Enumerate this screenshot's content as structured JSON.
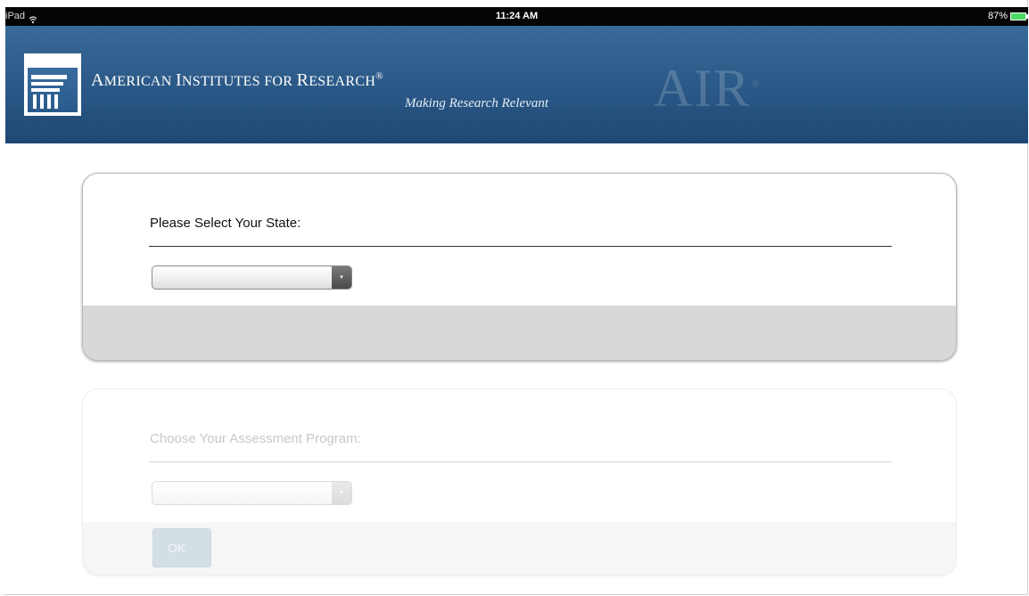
{
  "status_bar": {
    "device": "iPad",
    "time": "11:24 AM",
    "battery": "87%"
  },
  "header": {
    "brand_initial_1": "A",
    "brand_rest_1": "MERICAN ",
    "brand_initial_2": "I",
    "brand_rest_2": "NSTITUTES FOR ",
    "brand_initial_3": "R",
    "brand_rest_3": "ESEARCH",
    "brand_reg": "®",
    "tagline": "Making Research Relevant",
    "watermark": "AIR",
    "watermark_reg": "®"
  },
  "state_panel": {
    "label": "Please Select Your State:",
    "selected_value": "",
    "arrow_glyph": "▾"
  },
  "program_panel": {
    "label": "Choose Your Assessment Program:",
    "selected_value": "",
    "arrow_glyph": "▾",
    "ok_label": "OK"
  },
  "colors": {
    "header_top": "#3a6a98",
    "header_bottom": "#1e4775",
    "status_bar": "#050505",
    "battery": "#4cd964",
    "panel_footer_active": "#d8d8d8",
    "ok_button_disabled": "#d3dfe4"
  }
}
